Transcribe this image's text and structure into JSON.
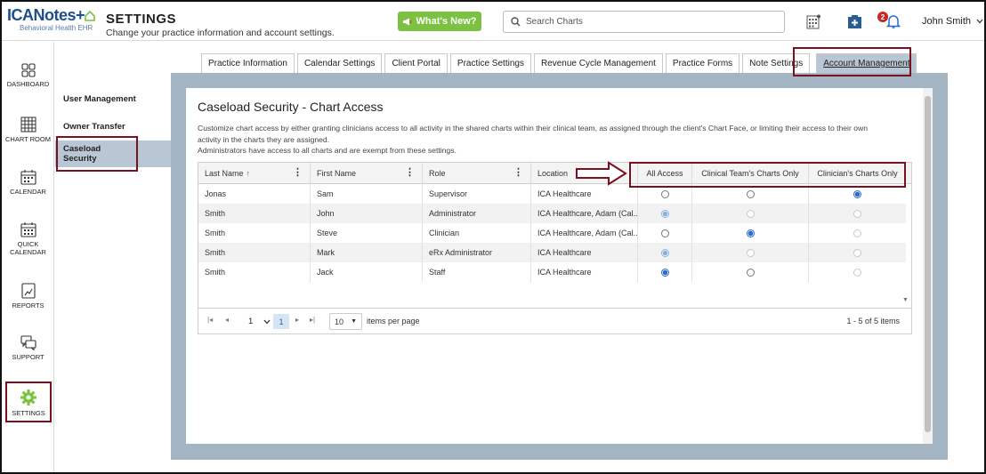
{
  "app": {
    "logo_text": "ICANotes",
    "logo_sub": "Behavioral Health EHR",
    "page_title": "SETTINGS",
    "page_subtitle": "Change your practice information and account settings.",
    "whats_new": "What's New?",
    "search_placeholder": "Search Charts",
    "notification_count": "2",
    "user_name": "John Smith"
  },
  "leftnav": [
    {
      "label": "DASHBOARD",
      "icon": "dashboard-icon"
    },
    {
      "label": "CHART ROOM",
      "icon": "chart-room-icon"
    },
    {
      "label": "CALENDAR",
      "icon": "calendar-icon"
    },
    {
      "label": "QUICK CALENDAR",
      "icon": "quick-calendar-icon"
    },
    {
      "label": "REPORTS",
      "icon": "reports-icon"
    },
    {
      "label": "SUPPORT",
      "icon": "support-icon"
    },
    {
      "label": "SETTINGS",
      "icon": "settings-icon"
    }
  ],
  "subnav": [
    "User Management",
    "Owner Transfer",
    "Caseload Security"
  ],
  "tabs": [
    "Practice Information",
    "Calendar Settings",
    "Client Portal",
    "Practice Settings",
    "Revenue Cycle Management",
    "Practice Forms",
    "Note Settings",
    "Account Management"
  ],
  "active_tab": "Account Management",
  "section": {
    "title": "Caseload Security - Chart Access",
    "desc_line1": "Customize chart access by either granting clinicians access to all activity in the shared charts within their clinical team, as assigned through the client's Chart Face, or limiting their access to their own",
    "desc_line2": "activity in the charts they are assigned.",
    "desc_line3": "Administrators have access to all charts and are exempt from these settings."
  },
  "grid": {
    "columns": [
      "Last Name",
      "First Name",
      "Role",
      "Location",
      "All Access",
      "Clinical Team's Charts Only",
      "Clinician's Charts Only"
    ],
    "sort_arrow": "↑",
    "rows": [
      {
        "last": "Jonas",
        "first": "Sam",
        "role": "Supervisor",
        "location": "ICA Healthcare",
        "access": "clinician",
        "admin": false
      },
      {
        "last": "Smith",
        "first": "John",
        "role": "Administrator",
        "location": "ICA Healthcare, Adam (Cal...",
        "access": "all",
        "admin": true
      },
      {
        "last": "Smith",
        "first": "Steve",
        "role": "Clinician",
        "location": "ICA Healthcare, Adam (Cal...",
        "access": "team",
        "admin": false
      },
      {
        "last": "Smith",
        "first": "Mark",
        "role": "eRx Administrator",
        "location": "ICA Healthcare",
        "access": "all",
        "admin": true
      },
      {
        "last": "Smith",
        "first": "Jack",
        "role": "Staff",
        "location": "ICA Healthcare",
        "access": "all",
        "admin": false
      }
    ]
  },
  "pager": {
    "page": "1",
    "page_number": "1",
    "page_size": "10",
    "items_per_page": "items per page",
    "count": "1 - 5 of 5 items"
  }
}
